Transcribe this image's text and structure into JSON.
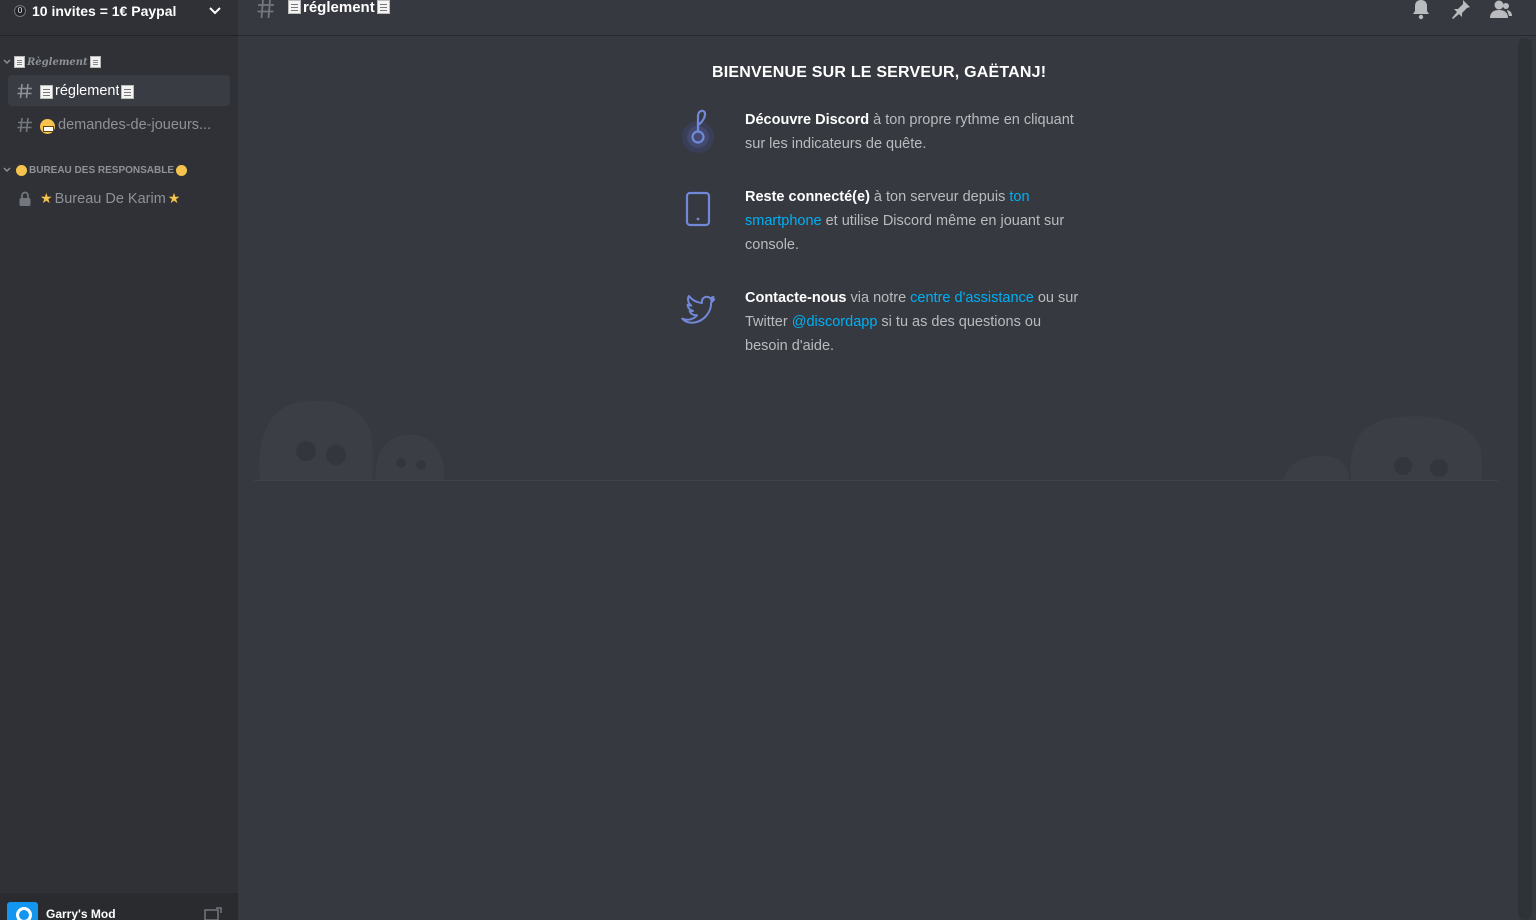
{
  "server": {
    "badge": "0",
    "name": "10 invites = 1€ Paypal"
  },
  "sidebar": {
    "categories": [
      {
        "label": "Règlement"
      },
      {
        "label": "BUREAU DES RESPONSABLE"
      }
    ],
    "channels": [
      {
        "type": "text",
        "label": "réglement",
        "selected": true
      },
      {
        "type": "text",
        "label": "demandes-de-joueurs..."
      },
      {
        "type": "locked-voice",
        "label": "Bureau De Karim"
      }
    ]
  },
  "user_panel": {
    "activity": "Garry's Mod"
  },
  "topbar": {
    "channel_name": "réglement",
    "icons": [
      "bell-icon",
      "pin-icon",
      "members-icon"
    ]
  },
  "welcome": {
    "title": "BIENVENUE SUR LE SERVEUR, GAËTANJ!",
    "tips": [
      {
        "icon": "quest-indicator-icon",
        "bold": "Découvre Discord",
        "text": " à ton propre rythme en cliquant sur les indicateurs de quête."
      },
      {
        "icon": "smartphone-icon",
        "bold": "Reste connecté(e)",
        "text_before": " à ton serveur depuis ",
        "link": "ton smartphone",
        "text_after": " et utilise Discord même en jouant sur console."
      },
      {
        "icon": "twitter-icon",
        "bold": "Contacte-nous",
        "text_before": " via notre ",
        "link1": "centre d'assistance",
        "text_middle": " ou sur Twitter ",
        "link2": "@discordapp",
        "text_after": " si tu as des questions ou besoin d'aide."
      }
    ]
  },
  "colors": {
    "sidebar_bg": "#2f3136",
    "main_bg": "#36393f",
    "link": "#00b0f4",
    "accent": "#7289da"
  }
}
